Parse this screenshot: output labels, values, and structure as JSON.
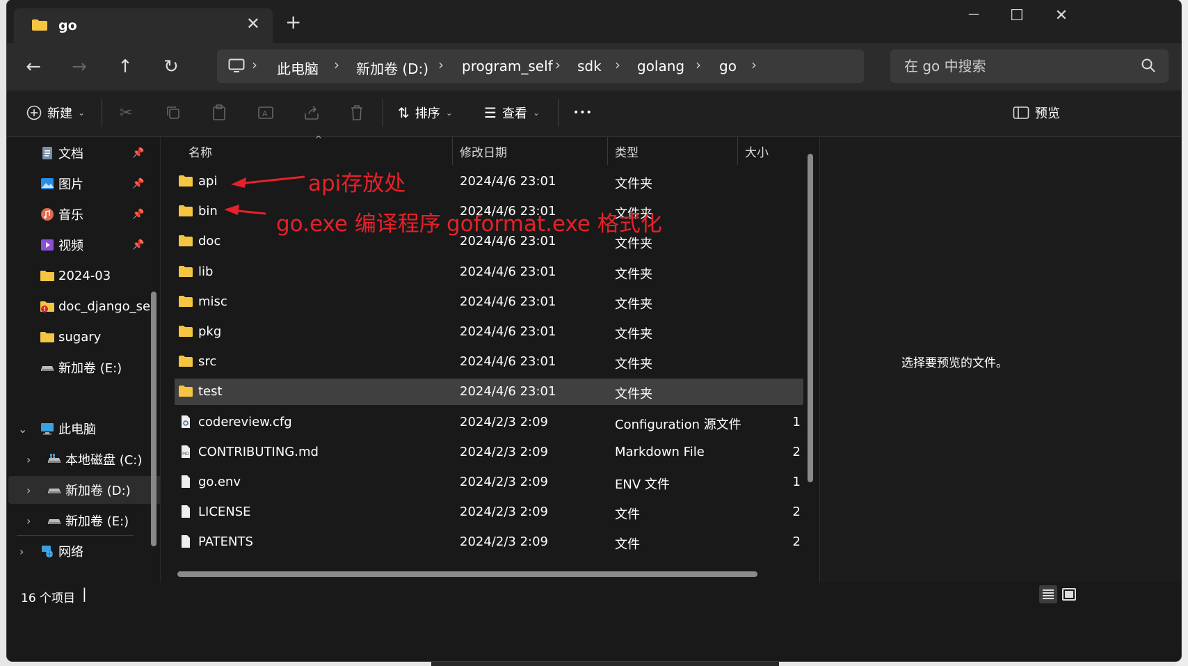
{
  "window": {
    "tab_title": "go",
    "tab_close": "✕",
    "new_tab": "+",
    "minimize": "—",
    "maximize": "☐",
    "close": "✕"
  },
  "nav_buttons": {
    "back": "←",
    "forward": "→",
    "up": "↑",
    "refresh": "↻"
  },
  "breadcrumb": [
    "此电脑",
    "新加卷 (D:)",
    "program_self",
    "sdk",
    "golang",
    "go"
  ],
  "search": {
    "placeholder": "在 go 中搜索"
  },
  "toolbar": {
    "new_label": "新建",
    "sort_label": "排序",
    "view_label": "查看",
    "more_label": "•••",
    "preview_label": "预览"
  },
  "sidebar": {
    "quick": [
      {
        "label": "文档",
        "icon": "document-icon",
        "pinned": true
      },
      {
        "label": "图片",
        "icon": "pictures-icon",
        "pinned": true
      },
      {
        "label": "音乐",
        "icon": "music-icon",
        "pinned": true
      },
      {
        "label": "视频",
        "icon": "video-icon",
        "pinned": true
      },
      {
        "label": "2024-03",
        "icon": "folder-icon",
        "pinned": false
      },
      {
        "label": "doc_django_se",
        "icon": "folder-icon",
        "pinned": false
      },
      {
        "label": "sugary",
        "icon": "folder-icon",
        "pinned": false
      },
      {
        "label": "新加卷 (E:)",
        "icon": "drive-icon",
        "pinned": false
      }
    ],
    "this_pc": "此电脑",
    "drives": [
      "本地磁盘 (C:)",
      "新加卷 (D:)",
      "新加卷 (E:)"
    ],
    "network": "网络"
  },
  "columns": {
    "name": "名称",
    "date": "修改日期",
    "type": "类型",
    "size": "大小"
  },
  "files": [
    {
      "name": "api",
      "date": "2024/4/6 23:01",
      "type": "文件夹",
      "size": "",
      "kind": "folder"
    },
    {
      "name": "bin",
      "date": "2024/4/6 23:01",
      "type": "文件夹",
      "size": "",
      "kind": "folder"
    },
    {
      "name": "doc",
      "date": "2024/4/6 23:01",
      "type": "文件夹",
      "size": "",
      "kind": "folder"
    },
    {
      "name": "lib",
      "date": "2024/4/6 23:01",
      "type": "文件夹",
      "size": "",
      "kind": "folder"
    },
    {
      "name": "misc",
      "date": "2024/4/6 23:01",
      "type": "文件夹",
      "size": "",
      "kind": "folder"
    },
    {
      "name": "pkg",
      "date": "2024/4/6 23:01",
      "type": "文件夹",
      "size": "",
      "kind": "folder"
    },
    {
      "name": "src",
      "date": "2024/4/6 23:01",
      "type": "文件夹",
      "size": "",
      "kind": "folder"
    },
    {
      "name": "test",
      "date": "2024/4/6 23:01",
      "type": "文件夹",
      "size": "",
      "kind": "folder"
    },
    {
      "name": "codereview.cfg",
      "date": "2024/2/3 2:09",
      "type": "Configuration 源文件",
      "size": "1",
      "kind": "config"
    },
    {
      "name": "CONTRIBUTING.md",
      "date": "2024/2/3 2:09",
      "type": "Markdown File",
      "size": "2",
      "kind": "markdown"
    },
    {
      "name": "go.env",
      "date": "2024/2/3 2:09",
      "type": "ENV 文件",
      "size": "1",
      "kind": "file"
    },
    {
      "name": "LICENSE",
      "date": "2024/2/3 2:09",
      "type": "文件",
      "size": "2",
      "kind": "file"
    },
    {
      "name": "PATENTS",
      "date": "2024/2/3 2:09",
      "type": "文件",
      "size": "2",
      "kind": "file"
    }
  ],
  "selected_row": "test",
  "preview_message": "选择要预览的文件。",
  "status": {
    "count": "16 个项目",
    "caret": "|"
  },
  "annotations": {
    "api_note": "api存放处",
    "bin_note_go": "go.exe 编译程序",
    "bin_note_gofmt": "goformat.exe 格式化"
  },
  "colors": {
    "folder": "#f5c542",
    "annotation": "#e6212a",
    "selection": "#404040",
    "accent": "#4aa3ff"
  }
}
